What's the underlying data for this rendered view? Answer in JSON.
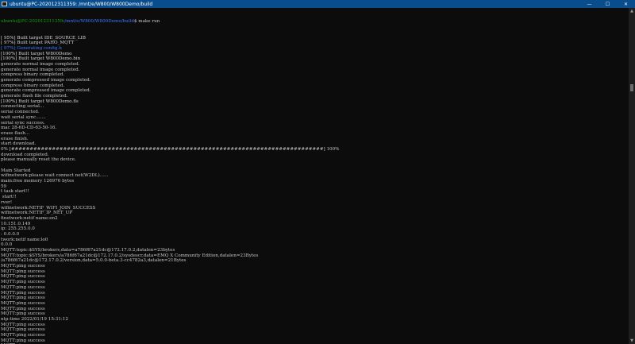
{
  "window": {
    "title": "ubuntu@PC-202012311359: /mnt/e/W800/W800Demo/build",
    "controls": {
      "minimize": "—",
      "maximize": "☐",
      "close": "✕"
    }
  },
  "prompt": {
    "user": "ubuntu@PC-202012311359",
    "colon": ":",
    "path": "/mnt/e/W800/W800Demo/build",
    "symbol": "$",
    "command": " make run"
  },
  "lines": [
    {
      "text": "[ 95%] Built target IDE_SOURCE_LIB",
      "style": "white"
    },
    {
      "text": "[ 97%] Built target PAHO_MQTT",
      "style": "white"
    },
    {
      "text": "[ 97%] Generating config.h",
      "style": "blue"
    },
    {
      "text": "[100%] Built target W800Demo",
      "style": "white"
    },
    {
      "text": "[100%] Built target W800Demo.bin",
      "style": "white"
    },
    {
      "text": "generate normal image completed.",
      "style": ""
    },
    {
      "text": "generate normal image completed.",
      "style": ""
    },
    {
      "text": "compress binary completed.",
      "style": ""
    },
    {
      "text": "generate compressed image completed.",
      "style": ""
    },
    {
      "text": "compress binary completed.",
      "style": ""
    },
    {
      "text": "generate compressed image completed.",
      "style": ""
    },
    {
      "text": "generate flash file completed.",
      "style": ""
    },
    {
      "text": "[100%] Built target W800Demo.fls",
      "style": "white"
    },
    {
      "text": "connecting serial...",
      "style": ""
    },
    {
      "text": "serial connected.",
      "style": ""
    },
    {
      "text": "wait serial sync.......",
      "style": ""
    },
    {
      "text": "serial sync success.",
      "style": ""
    },
    {
      "text": "mac 28-6D-CD-63-50-16.",
      "style": ""
    },
    {
      "text": "erase flash...",
      "style": ""
    },
    {
      "text": "erase finish.",
      "style": ""
    },
    {
      "text": "start download.",
      "style": ""
    },
    {
      "text": "0% [####################################################################################] 100%",
      "style": ""
    },
    {
      "text": "download completed.",
      "style": ""
    },
    {
      "text": "please manually reset the device.",
      "style": ""
    },
    {
      "text": "",
      "style": ""
    },
    {
      "text": "Main Started",
      "style": ""
    },
    {
      "text": "wifinetwork:please wait connect net(W2DL)......",
      "style": ""
    },
    {
      "text": "main:free memory 126976 bytes",
      "style": ""
    },
    {
      "text": "59",
      "style": ""
    },
    {
      "text": "t task start!!",
      "style": ""
    },
    {
      "text": " start!!",
      "style": ""
    },
    {
      "text": "rver!",
      "style": ""
    },
    {
      "text": "wifinetwork:NETIF_WIFI_JOIN_SUCCESS",
      "style": ""
    },
    {
      "text": "wifinetwork:NETIF_IP_NET_UP",
      "style": ""
    },
    {
      "text": "finetwork:netif name:en2",
      "style": ""
    },
    {
      "text": "10.151.0.149",
      "style": ""
    },
    {
      "text": "ip: 255.255.0.0",
      "style": ""
    },
    {
      "text": ": 0.0.0.0",
      "style": ""
    },
    {
      "text": "twork:netif name:lo0",
      "style": ""
    },
    {
      "text": "0.0.0",
      "style": ""
    },
    {
      "text": "MQTT:topic:$SYS/brokers,data=a786f67a21dc@172.17.0.2,datalen=23bytes",
      "style": ""
    },
    {
      "text": "MQTT:topic:$SYS/brokers/a786f67a21dc@172.17.0.2/sysdescr,data=EMQ X Community Edition,datalen=23Bytes",
      "style": ""
    },
    {
      "text": "/a786f67a21dc@172.17.0.2/version,data=5.0.0-beta.3-cc4782a3,datalen=21Bytes",
      "style": ""
    },
    {
      "text": "MQTT:ping success",
      "style": ""
    },
    {
      "text": "MQTT:ping success",
      "style": ""
    },
    {
      "text": "MQTT:ping success",
      "style": ""
    },
    {
      "text": "MQTT:ping success",
      "style": ""
    },
    {
      "text": "MQTT:ping success",
      "style": ""
    },
    {
      "text": "MQTT:ping success",
      "style": ""
    },
    {
      "text": "MQTT:ping success",
      "style": ""
    },
    {
      "text": "MQTT:ping success",
      "style": ""
    },
    {
      "text": "MQTT:ping success",
      "style": ""
    },
    {
      "text": "MQTT:ping success",
      "style": ""
    },
    {
      "text": "ntp:time 2022/01/19 15:31:12",
      "style": ""
    },
    {
      "text": "MQTT:ping success",
      "style": ""
    },
    {
      "text": "MQTT:ping success",
      "style": ""
    },
    {
      "text": "MQTT:ping success",
      "style": ""
    },
    {
      "text": "MQTT:ping success",
      "style": ""
    },
    {
      "text": "MQTT:ping success",
      "style": ""
    },
    {
      "text": "MQTT:ping success",
      "style": ""
    },
    {
      "text": "MQTT:ping success",
      "style": ""
    }
  ],
  "scrollbar": {
    "up_arrow": "▲",
    "down_arrow": "▼"
  },
  "colors": {
    "titlebar": "#0a4d8c",
    "background": "#0c0c0c",
    "text": "#c8c8c8",
    "prompt_user": "#13a10e",
    "prompt_path": "#3b78ff"
  }
}
